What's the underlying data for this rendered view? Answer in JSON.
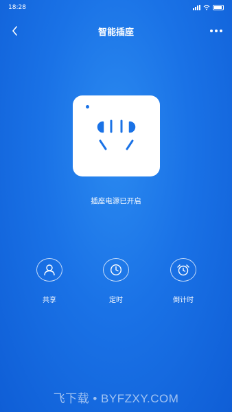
{
  "status_bar": {
    "time": "18:28"
  },
  "header": {
    "title": "智能插座",
    "back_icon": "chevron-left-icon",
    "more_icon": "more-dots-icon"
  },
  "device": {
    "icon": "power-socket-icon",
    "status_text": "插座电源已开启"
  },
  "actions": [
    {
      "label": "共享",
      "icon": "user-icon"
    },
    {
      "label": "定时",
      "icon": "clock-icon"
    },
    {
      "label": "倒计时",
      "icon": "alarm-clock-icon"
    }
  ],
  "watermark": "飞下载 • BYFZXY.COM",
  "colors": {
    "background": "#1a72e6",
    "card": "#ffffff",
    "accent": "#1a72e6"
  }
}
